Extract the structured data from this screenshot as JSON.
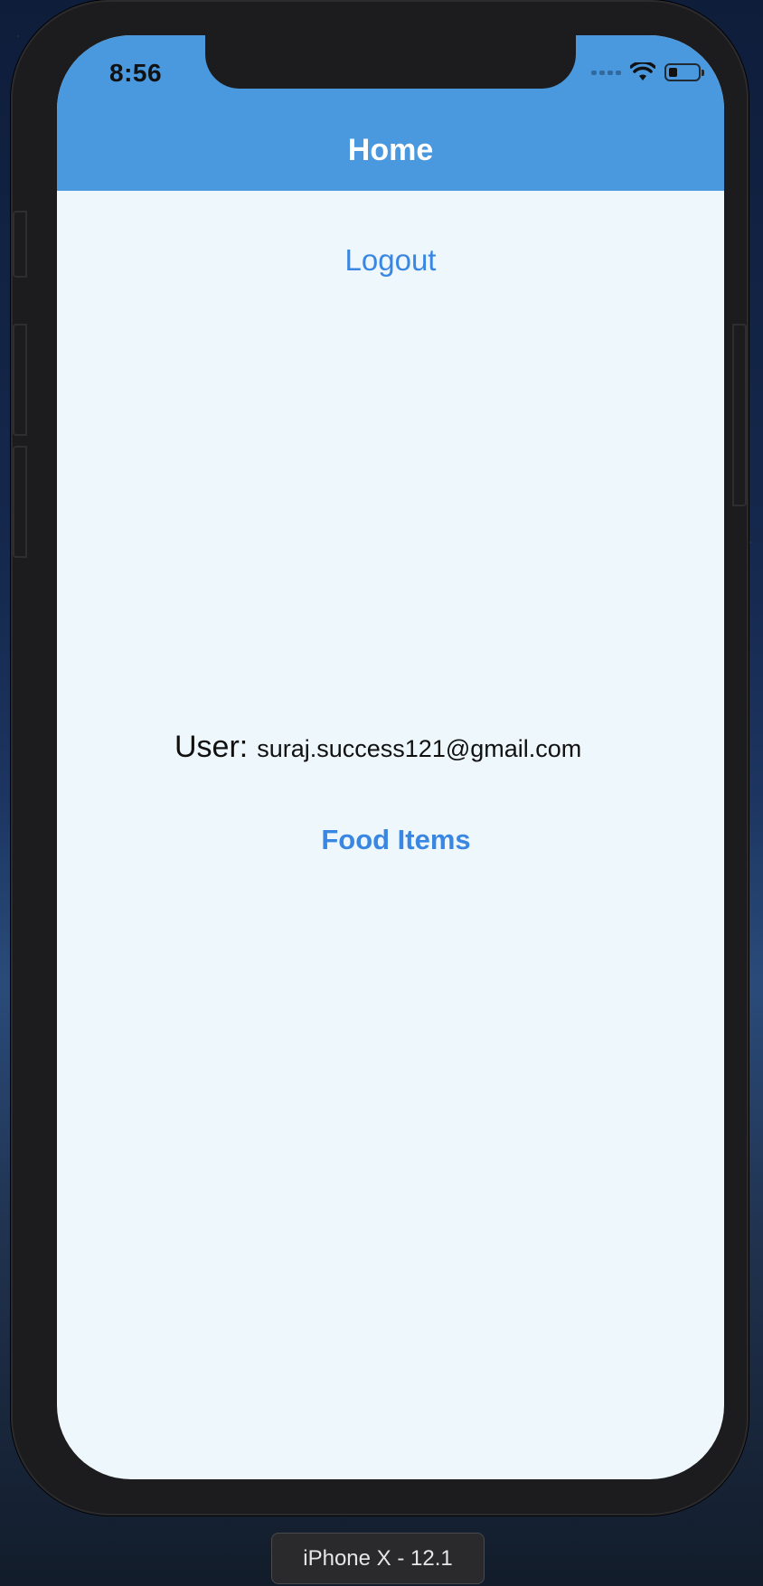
{
  "status_bar": {
    "time": "8:56",
    "battery_level": 0.3
  },
  "header": {
    "title": "Home",
    "background_color": "#4a98de"
  },
  "actions": {
    "logout_label": "Logout",
    "food_items_label": "Food Items",
    "link_color": "#3a86e3"
  },
  "user": {
    "label": "User:",
    "email": "suraj.success121@gmail.com"
  },
  "simulator": {
    "device_label": "iPhone X - 12.1"
  },
  "icons": {
    "wifi": "wifi-icon",
    "battery": "battery-icon",
    "signal": "cellular-signal-icon"
  }
}
